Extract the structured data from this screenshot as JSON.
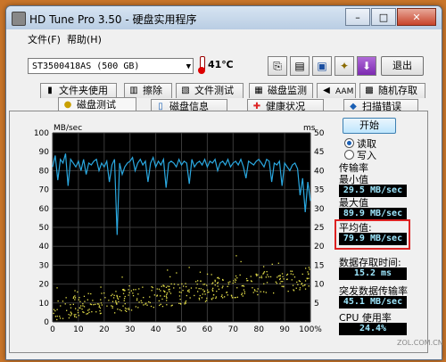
{
  "window": {
    "title": "HD Tune Pro 3.50 - 硬盘实用程序"
  },
  "menu": {
    "file": "文件(F)",
    "help": "帮助(H)"
  },
  "toolbar": {
    "drive": "ST3500418AS (500 GB)",
    "temperature": "41℃",
    "exit_label": "退出",
    "buttons": [
      "copy-icon",
      "copy-text-icon",
      "save-icon",
      "options-icon",
      "download-icon"
    ]
  },
  "tabs_row1": [
    "文件夹使用率",
    "擦除",
    "文件测试",
    "磁盘监测",
    "AAM",
    "随机存取"
  ],
  "tabs_row2": [
    "磁盘测试",
    "磁盘信息",
    "健康状况",
    "扫描错误"
  ],
  "side": {
    "start_label": "开始",
    "read_label": "读取",
    "write_label": "写入",
    "transfer_label": "传输率",
    "min_label": "最小值",
    "min_value": "29.5 MB/sec",
    "max_label": "最大值",
    "max_value": "89.9 MB/sec",
    "avg_label": "平均值:",
    "avg_value": "79.9 MB/sec",
    "access_label": "数据存取时间:",
    "access_value": "15.2 ms",
    "burst_label": "突发数据传输率",
    "burst_value": "45.1 MB/sec",
    "cpu_label": "CPU 使用率",
    "cpu_value": "24.4%"
  },
  "watermark": "ZOL.COM.CN",
  "colors": {
    "transfer": "#2aa8e0",
    "access": "#e6e04a",
    "plot_bg": "#000000",
    "grid": "#3a3a3a"
  },
  "chart_data": {
    "type": "line",
    "left_axis_unit": "MB/sec",
    "right_axis_unit": "ms",
    "ylim_left": [
      0,
      100
    ],
    "ylim_right": [
      0,
      50
    ],
    "yticks_left": [
      0,
      10,
      20,
      30,
      40,
      50,
      60,
      70,
      80,
      90,
      100
    ],
    "yticks_right": [
      5,
      10,
      15,
      20,
      25,
      30,
      35,
      40,
      45,
      50
    ],
    "xticks": [
      "0",
      "10",
      "20",
      "30",
      "40",
      "50",
      "60",
      "70",
      "80",
      "90",
      "100%"
    ],
    "xlim": [
      0,
      100
    ],
    "series": [
      {
        "axis": "left",
        "x": [
          0,
          1,
          2,
          3,
          4,
          5,
          6,
          7,
          8,
          9,
          10,
          11,
          12,
          13,
          14,
          15,
          16,
          17,
          18,
          19,
          20,
          21,
          22,
          23,
          24,
          25,
          26,
          27,
          28,
          29,
          30,
          31,
          32,
          33,
          34,
          35,
          36,
          37,
          38,
          39,
          40,
          41,
          42,
          43,
          44,
          45,
          46,
          47,
          48,
          49,
          50,
          51,
          52,
          53,
          54,
          55,
          56,
          57,
          58,
          59,
          60,
          61,
          62,
          63,
          64,
          65,
          66,
          67,
          68,
          69,
          70,
          71,
          72,
          73,
          74,
          75,
          76,
          77,
          78,
          79,
          80,
          81,
          82,
          83,
          84,
          85,
          86,
          87,
          88,
          89,
          90,
          91,
          92,
          93,
          94,
          95,
          96,
          97,
          98,
          99,
          100
        ],
        "values": [
          82,
          88,
          75,
          86,
          84,
          89,
          72,
          86,
          84,
          82,
          85,
          80,
          86,
          78,
          84,
          83,
          85,
          86,
          80,
          84,
          82,
          85,
          74,
          83,
          86,
          46,
          84,
          78,
          82,
          84,
          85,
          87,
          80,
          84,
          86,
          83,
          85,
          74,
          84,
          87,
          82,
          85,
          83,
          86,
          71,
          84,
          85,
          84,
          82,
          86,
          83,
          85,
          84,
          73,
          86,
          82,
          84,
          85,
          83,
          86,
          82,
          85,
          84,
          86,
          80,
          84,
          85,
          83,
          86,
          82,
          84,
          85,
          83,
          86,
          82,
          76,
          85,
          84,
          83,
          85,
          86,
          84,
          82,
          86,
          85,
          74,
          84,
          83,
          85,
          72,
          84,
          82,
          80,
          83,
          84,
          81,
          67,
          76,
          58,
          74,
          64
        ]
      }
    ]
  }
}
